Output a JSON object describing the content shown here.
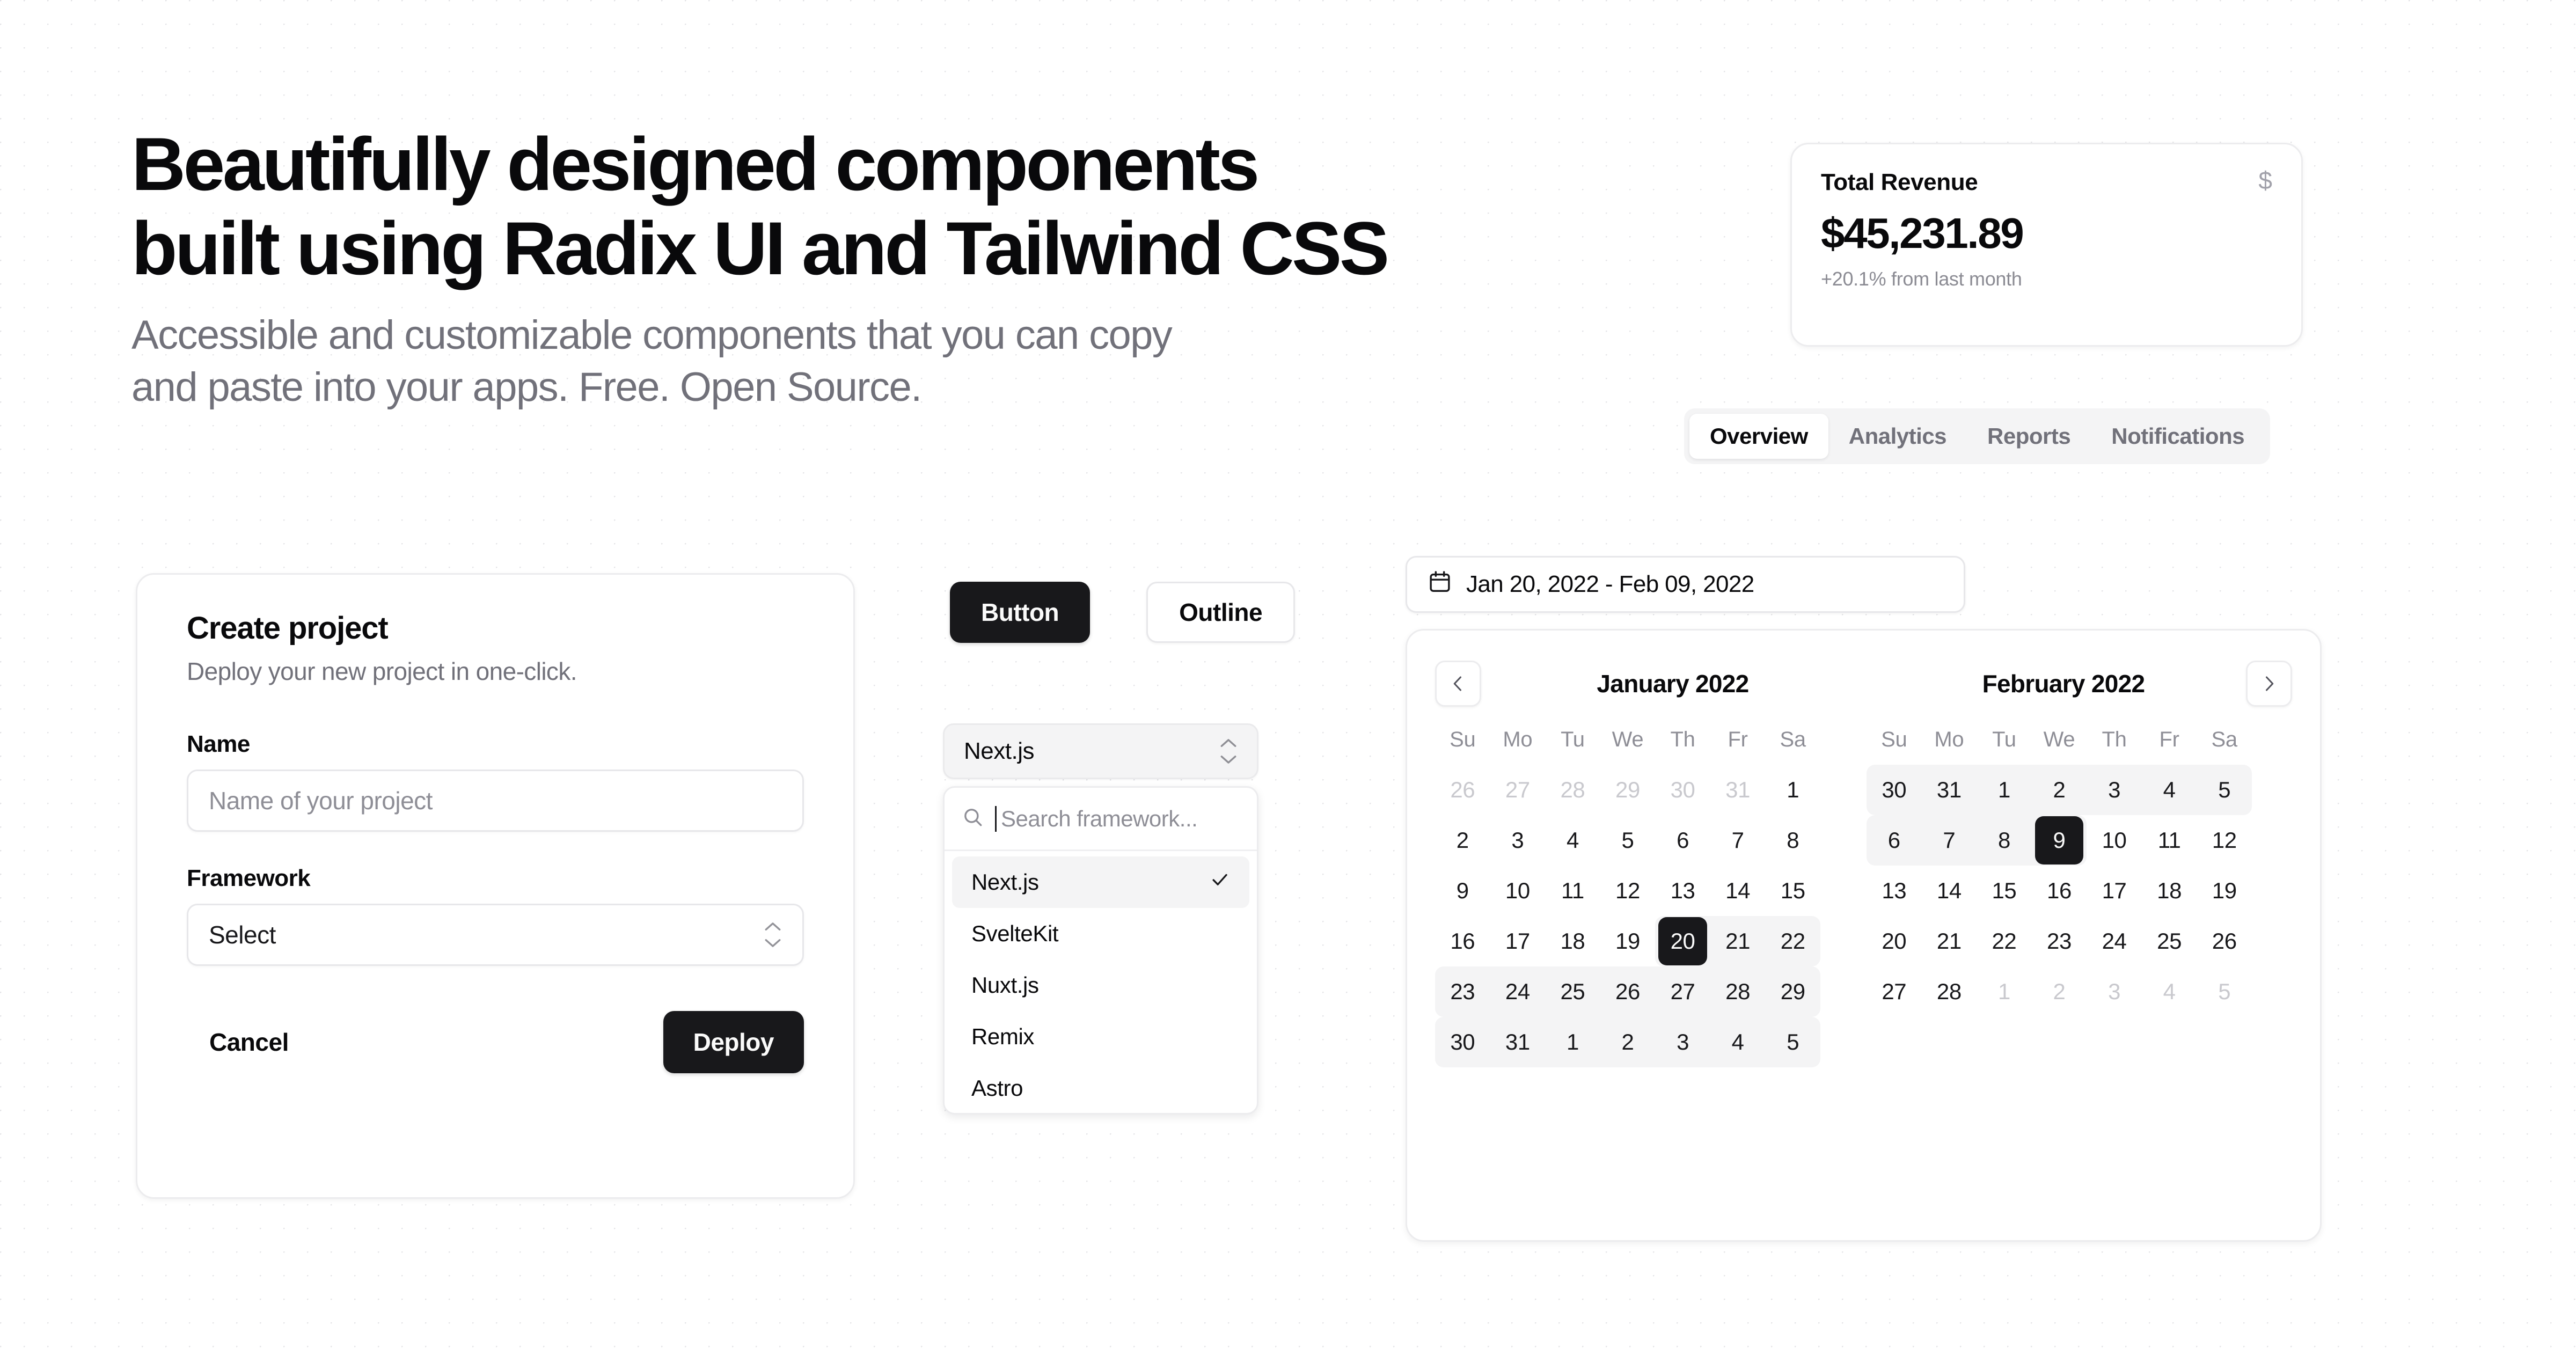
{
  "hero": {
    "title_line1": "Beautifully designed components",
    "title_line2": "built using Radix UI and Tailwind CSS",
    "subtitle_line1": "Accessible and customizable components that you can copy",
    "subtitle_line2": "and paste into your apps. Free. Open Source."
  },
  "revenue_card": {
    "title": "Total Revenue",
    "icon": "dollar-sign-icon",
    "icon_glyph": "$",
    "value": "$45,231.89",
    "subtitle": "+20.1% from last month"
  },
  "tabs": {
    "items": [
      {
        "label": "Overview",
        "active": true
      },
      {
        "label": "Analytics",
        "active": false
      },
      {
        "label": "Reports",
        "active": false
      },
      {
        "label": "Notifications",
        "active": false
      }
    ]
  },
  "create_project": {
    "title": "Create project",
    "description": "Deploy your new project in one-click.",
    "name_label": "Name",
    "name_placeholder": "Name of your project",
    "name_value": "",
    "framework_label": "Framework",
    "framework_value": "Select",
    "cancel_label": "Cancel",
    "deploy_label": "Deploy"
  },
  "buttons": {
    "default_label": "Button",
    "outline_label": "Outline"
  },
  "combobox": {
    "trigger_value": "Next.js",
    "search_placeholder": "Search framework...",
    "search_value": "",
    "options": [
      {
        "label": "Next.js",
        "selected": true
      },
      {
        "label": "SvelteKit",
        "selected": false
      },
      {
        "label": "Nuxt.js",
        "selected": false
      },
      {
        "label": "Remix",
        "selected": false
      },
      {
        "label": "Astro",
        "selected": false
      }
    ]
  },
  "date_picker": {
    "range_label": "Jan 20, 2022 - Feb 09, 2022",
    "weekdays": [
      "Su",
      "Mo",
      "Tu",
      "We",
      "Th",
      "Fr",
      "Sa"
    ],
    "prev_label": "‹",
    "next_label": "›",
    "months": [
      {
        "caption": "January 2022",
        "weeks": [
          [
            {
              "d": "26",
              "state": "muted"
            },
            {
              "d": "27",
              "state": "muted"
            },
            {
              "d": "28",
              "state": "muted"
            },
            {
              "d": "29",
              "state": "muted"
            },
            {
              "d": "30",
              "state": "muted"
            },
            {
              "d": "31",
              "state": "muted"
            },
            {
              "d": "1",
              "state": "normal"
            }
          ],
          [
            {
              "d": "2",
              "state": "normal"
            },
            {
              "d": "3",
              "state": "normal"
            },
            {
              "d": "4",
              "state": "normal"
            },
            {
              "d": "5",
              "state": "normal"
            },
            {
              "d": "6",
              "state": "normal"
            },
            {
              "d": "7",
              "state": "normal"
            },
            {
              "d": "8",
              "state": "normal"
            }
          ],
          [
            {
              "d": "9",
              "state": "normal"
            },
            {
              "d": "10",
              "state": "normal"
            },
            {
              "d": "11",
              "state": "normal"
            },
            {
              "d": "12",
              "state": "normal"
            },
            {
              "d": "13",
              "state": "normal"
            },
            {
              "d": "14",
              "state": "normal"
            },
            {
              "d": "15",
              "state": "normal"
            }
          ],
          [
            {
              "d": "16",
              "state": "normal"
            },
            {
              "d": "17",
              "state": "normal"
            },
            {
              "d": "18",
              "state": "normal"
            },
            {
              "d": "19",
              "state": "normal"
            },
            {
              "d": "20",
              "state": "selected-start"
            },
            {
              "d": "21",
              "state": "in-range"
            },
            {
              "d": "22",
              "state": "range-end"
            }
          ],
          [
            {
              "d": "23",
              "state": "range-start"
            },
            {
              "d": "24",
              "state": "in-range"
            },
            {
              "d": "25",
              "state": "in-range"
            },
            {
              "d": "26",
              "state": "in-range"
            },
            {
              "d": "27",
              "state": "in-range"
            },
            {
              "d": "28",
              "state": "in-range"
            },
            {
              "d": "29",
              "state": "range-end"
            }
          ],
          [
            {
              "d": "30",
              "state": "range-start"
            },
            {
              "d": "31",
              "state": "in-range"
            },
            {
              "d": "1",
              "state": "in-range"
            },
            {
              "d": "2",
              "state": "in-range"
            },
            {
              "d": "3",
              "state": "in-range"
            },
            {
              "d": "4",
              "state": "in-range"
            },
            {
              "d": "5",
              "state": "range-end"
            }
          ]
        ]
      },
      {
        "caption": "February 2022",
        "weeks": [
          [
            {
              "d": "30",
              "state": "range-start"
            },
            {
              "d": "31",
              "state": "in-range"
            },
            {
              "d": "1",
              "state": "in-range"
            },
            {
              "d": "2",
              "state": "in-range"
            },
            {
              "d": "3",
              "state": "in-range"
            },
            {
              "d": "4",
              "state": "in-range"
            },
            {
              "d": "5",
              "state": "range-end"
            }
          ],
          [
            {
              "d": "6",
              "state": "range-start"
            },
            {
              "d": "7",
              "state": "in-range"
            },
            {
              "d": "8",
              "state": "in-range"
            },
            {
              "d": "9",
              "state": "selected-end"
            },
            {
              "d": "10",
              "state": "normal"
            },
            {
              "d": "11",
              "state": "normal"
            },
            {
              "d": "12",
              "state": "normal"
            }
          ],
          [
            {
              "d": "13",
              "state": "normal"
            },
            {
              "d": "14",
              "state": "normal"
            },
            {
              "d": "15",
              "state": "normal"
            },
            {
              "d": "16",
              "state": "normal"
            },
            {
              "d": "17",
              "state": "normal"
            },
            {
              "d": "18",
              "state": "normal"
            },
            {
              "d": "19",
              "state": "normal"
            }
          ],
          [
            {
              "d": "20",
              "state": "normal"
            },
            {
              "d": "21",
              "state": "normal"
            },
            {
              "d": "22",
              "state": "normal"
            },
            {
              "d": "23",
              "state": "normal"
            },
            {
              "d": "24",
              "state": "normal"
            },
            {
              "d": "25",
              "state": "normal"
            },
            {
              "d": "26",
              "state": "normal"
            }
          ],
          [
            {
              "d": "27",
              "state": "normal"
            },
            {
              "d": "28",
              "state": "normal"
            },
            {
              "d": "1",
              "state": "muted"
            },
            {
              "d": "2",
              "state": "muted"
            },
            {
              "d": "3",
              "state": "muted"
            },
            {
              "d": "4",
              "state": "muted"
            },
            {
              "d": "5",
              "state": "muted"
            }
          ]
        ]
      }
    ]
  },
  "colors": {
    "foreground": "#09090b",
    "muted_foreground": "#71717a",
    "primary": "#18181b",
    "muted": "#f4f4f5",
    "border": "#e7e7ea",
    "background": "#ffffff"
  }
}
